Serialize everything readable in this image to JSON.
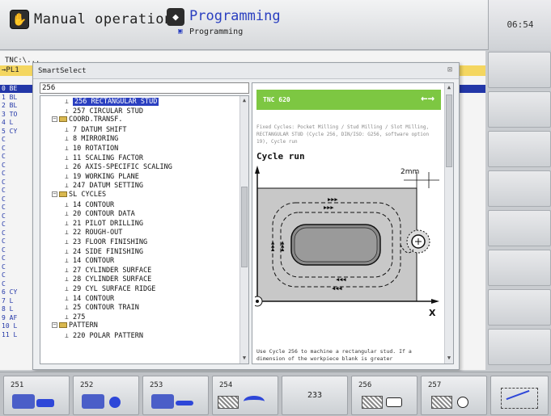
{
  "header": {
    "left_mode": "Manual operation",
    "right_mode": "Programming",
    "right_mode_sub": "Programming",
    "clock": "06:54"
  },
  "program": {
    "tnc_path": "TNC:\\...",
    "pgm_label": "→PL1",
    "lines": [
      "0 BE",
      "1 BL",
      "2 BL",
      "3 TO",
      "4 L",
      "5 CY",
      "C",
      "C",
      "C",
      "C",
      "C",
      "C",
      "C",
      "C",
      "C",
      "C",
      "C",
      "C",
      "C",
      "C",
      "C",
      "C",
      "C",
      "C",
      "6 CY",
      "7 L",
      "8 L",
      "9 AF",
      "10 L",
      "11 L"
    ]
  },
  "dialog": {
    "title": "SmartSelect",
    "close": "⊠",
    "search_value": "256"
  },
  "tree": [
    {
      "label": "256 RECTANGULAR STUD",
      "level": 2,
      "kind": "cycle",
      "selected": true
    },
    {
      "label": "257 CIRCULAR STUD",
      "level": 2,
      "kind": "cycle"
    },
    {
      "label": "COORD.TRANSF.",
      "level": 1,
      "kind": "folder"
    },
    {
      "label": "7 DATUM SHIFT",
      "level": 2,
      "kind": "cycle"
    },
    {
      "label": "8 MIRRORING",
      "level": 2,
      "kind": "cycle"
    },
    {
      "label": "10 ROTATION",
      "level": 2,
      "kind": "cycle"
    },
    {
      "label": "11 SCALING FACTOR",
      "level": 2,
      "kind": "cycle"
    },
    {
      "label": "26 AXIS-SPECIFIC SCALING",
      "level": 2,
      "kind": "cycle"
    },
    {
      "label": "19 WORKING PLANE",
      "level": 2,
      "kind": "cycle"
    },
    {
      "label": "247 DATUM SETTING",
      "level": 2,
      "kind": "cycle"
    },
    {
      "label": "SL CYCLES",
      "level": 1,
      "kind": "folder"
    },
    {
      "label": "14 CONTOUR",
      "level": 2,
      "kind": "cycle"
    },
    {
      "label": "20 CONTOUR DATA",
      "level": 2,
      "kind": "cycle"
    },
    {
      "label": "21 PILOT DRILLING",
      "level": 2,
      "kind": "cycle"
    },
    {
      "label": "22 ROUGH-OUT",
      "level": 2,
      "kind": "cycle"
    },
    {
      "label": "23 FLOOR FINISHING",
      "level": 2,
      "kind": "cycle"
    },
    {
      "label": "24 SIDE FINISHING",
      "level": 2,
      "kind": "cycle"
    },
    {
      "label": "14 CONTOUR",
      "level": 2,
      "kind": "cycle"
    },
    {
      "label": "27 CYLINDER SURFACE",
      "level": 2,
      "kind": "cycle"
    },
    {
      "label": "28 CYLINDER SURFACE",
      "level": 2,
      "kind": "cycle"
    },
    {
      "label": "29 CYL SURFACE RIDGE",
      "level": 2,
      "kind": "cycle"
    },
    {
      "label": "14 CONTOUR",
      "level": 2,
      "kind": "cycle"
    },
    {
      "label": "25 CONTOUR TRAIN",
      "level": 2,
      "kind": "cycle"
    },
    {
      "label": "275",
      "level": 2,
      "kind": "cycle"
    },
    {
      "label": "PATTERN",
      "level": 1,
      "kind": "folder"
    },
    {
      "label": "220 POLAR PATTERN",
      "level": 2,
      "kind": "cycle"
    }
  ],
  "help": {
    "banner": "TNC 620",
    "banner_arrows": "←→",
    "description": "Fixed Cycles: Pocket Milling / Stud Milling / Slot Milling, RECTANGULAR STUD (Cycle 256, DIN/ISO: G256, software option 19), Cycle run",
    "heading": "Cycle run",
    "dim_label": "2mm",
    "axis_x": "X",
    "footer": "Use Cycle 256 to machine a rectangular stud. If a dimension of the workpiece blank is greater"
  },
  "softkeys": [
    {
      "num": "251",
      "icon": "rect-pocket"
    },
    {
      "num": "252",
      "icon": "circ-pocket"
    },
    {
      "num": "253",
      "icon": "slot"
    },
    {
      "num": "254",
      "icon": "circ-slot"
    },
    {
      "num": "",
      "label": "233",
      "icon": "none"
    },
    {
      "num": "256",
      "icon": "rect-stud"
    },
    {
      "num": "257",
      "icon": "circ-stud"
    },
    {
      "num": "",
      "icon": "next"
    }
  ]
}
